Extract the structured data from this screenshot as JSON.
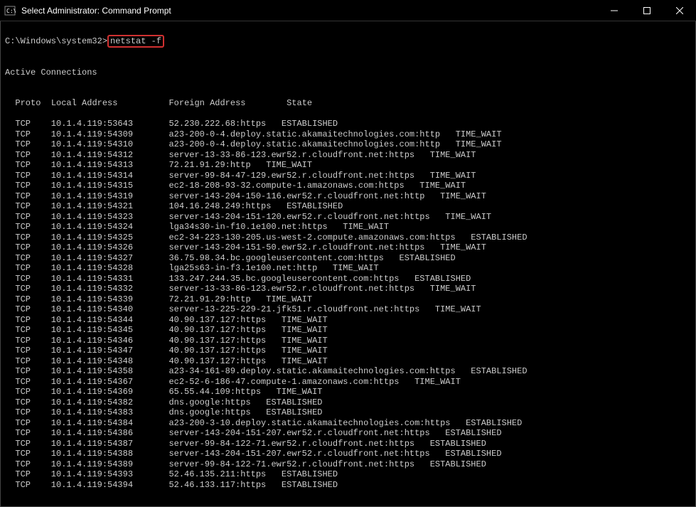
{
  "titlebar": {
    "title": "Select Administrator: Command Prompt"
  },
  "prompt": {
    "path": "C:\\Windows\\system32>",
    "command": "netstat -f"
  },
  "header": "Active Connections",
  "columns": {
    "proto": "Proto",
    "local": "Local Address",
    "foreign": "Foreign Address",
    "state": "State"
  },
  "connections": [
    {
      "proto": "TCP",
      "local": "10.1.4.119:53643",
      "foreign": "52.230.222.68:https",
      "state": "ESTABLISHED"
    },
    {
      "proto": "TCP",
      "local": "10.1.4.119:54309",
      "foreign": "a23-200-0-4.deploy.static.akamaitechnologies.com:http",
      "state": "TIME_WAIT"
    },
    {
      "proto": "TCP",
      "local": "10.1.4.119:54310",
      "foreign": "a23-200-0-4.deploy.static.akamaitechnologies.com:http",
      "state": "TIME_WAIT"
    },
    {
      "proto": "TCP",
      "local": "10.1.4.119:54312",
      "foreign": "server-13-33-86-123.ewr52.r.cloudfront.net:https",
      "state": "TIME_WAIT"
    },
    {
      "proto": "TCP",
      "local": "10.1.4.119:54313",
      "foreign": "72.21.91.29:http",
      "state": "TIME_WAIT"
    },
    {
      "proto": "TCP",
      "local": "10.1.4.119:54314",
      "foreign": "server-99-84-47-129.ewr52.r.cloudfront.net:https",
      "state": "TIME_WAIT"
    },
    {
      "proto": "TCP",
      "local": "10.1.4.119:54315",
      "foreign": "ec2-18-208-93-32.compute-1.amazonaws.com:https",
      "state": "TIME_WAIT"
    },
    {
      "proto": "TCP",
      "local": "10.1.4.119:54319",
      "foreign": "server-143-204-150-116.ewr52.r.cloudfront.net:http",
      "state": "TIME_WAIT"
    },
    {
      "proto": "TCP",
      "local": "10.1.4.119:54321",
      "foreign": "104.16.248.249:https",
      "state": "ESTABLISHED"
    },
    {
      "proto": "TCP",
      "local": "10.1.4.119:54323",
      "foreign": "server-143-204-151-120.ewr52.r.cloudfront.net:https",
      "state": "TIME_WAIT"
    },
    {
      "proto": "TCP",
      "local": "10.1.4.119:54324",
      "foreign": "lga34s30-in-f10.1e100.net:https",
      "state": "TIME_WAIT"
    },
    {
      "proto": "TCP",
      "local": "10.1.4.119:54325",
      "foreign": "ec2-34-223-130-205.us-west-2.compute.amazonaws.com:https",
      "state": "ESTABLISHED"
    },
    {
      "proto": "TCP",
      "local": "10.1.4.119:54326",
      "foreign": "server-143-204-151-50.ewr52.r.cloudfront.net:https",
      "state": "TIME_WAIT"
    },
    {
      "proto": "TCP",
      "local": "10.1.4.119:54327",
      "foreign": "36.75.98.34.bc.googleusercontent.com:https",
      "state": "ESTABLISHED"
    },
    {
      "proto": "TCP",
      "local": "10.1.4.119:54328",
      "foreign": "lga25s63-in-f3.1e100.net:http",
      "state": "TIME_WAIT"
    },
    {
      "proto": "TCP",
      "local": "10.1.4.119:54331",
      "foreign": "133.247.244.35.bc.googleusercontent.com:https",
      "state": "ESTABLISHED"
    },
    {
      "proto": "TCP",
      "local": "10.1.4.119:54332",
      "foreign": "server-13-33-86-123.ewr52.r.cloudfront.net:https",
      "state": "TIME_WAIT"
    },
    {
      "proto": "TCP",
      "local": "10.1.4.119:54339",
      "foreign": "72.21.91.29:http",
      "state": "TIME_WAIT"
    },
    {
      "proto": "TCP",
      "local": "10.1.4.119:54340",
      "foreign": "server-13-225-229-21.jfk51.r.cloudfront.net:https",
      "state": "TIME_WAIT"
    },
    {
      "proto": "TCP",
      "local": "10.1.4.119:54344",
      "foreign": "40.90.137.127:https",
      "state": "TIME_WAIT"
    },
    {
      "proto": "TCP",
      "local": "10.1.4.119:54345",
      "foreign": "40.90.137.127:https",
      "state": "TIME_WAIT"
    },
    {
      "proto": "TCP",
      "local": "10.1.4.119:54346",
      "foreign": "40.90.137.127:https",
      "state": "TIME_WAIT"
    },
    {
      "proto": "TCP",
      "local": "10.1.4.119:54347",
      "foreign": "40.90.137.127:https",
      "state": "TIME_WAIT"
    },
    {
      "proto": "TCP",
      "local": "10.1.4.119:54348",
      "foreign": "40.90.137.127:https",
      "state": "TIME_WAIT"
    },
    {
      "proto": "TCP",
      "local": "10.1.4.119:54358",
      "foreign": "a23-34-161-89.deploy.static.akamaitechnologies.com:https",
      "state": "ESTABLISHED"
    },
    {
      "proto": "TCP",
      "local": "10.1.4.119:54367",
      "foreign": "ec2-52-6-186-47.compute-1.amazonaws.com:https",
      "state": "TIME_WAIT"
    },
    {
      "proto": "TCP",
      "local": "10.1.4.119:54369",
      "foreign": "65.55.44.109:https",
      "state": "TIME_WAIT"
    },
    {
      "proto": "TCP",
      "local": "10.1.4.119:54382",
      "foreign": "dns.google:https",
      "state": "ESTABLISHED"
    },
    {
      "proto": "TCP",
      "local": "10.1.4.119:54383",
      "foreign": "dns.google:https",
      "state": "ESTABLISHED"
    },
    {
      "proto": "TCP",
      "local": "10.1.4.119:54384",
      "foreign": "a23-200-3-10.deploy.static.akamaitechnologies.com:https",
      "state": "ESTABLISHED"
    },
    {
      "proto": "TCP",
      "local": "10.1.4.119:54386",
      "foreign": "server-143-204-151-207.ewr52.r.cloudfront.net:https",
      "state": "ESTABLISHED"
    },
    {
      "proto": "TCP",
      "local": "10.1.4.119:54387",
      "foreign": "server-99-84-122-71.ewr52.r.cloudfront.net:https",
      "state": "ESTABLISHED"
    },
    {
      "proto": "TCP",
      "local": "10.1.4.119:54388",
      "foreign": "server-143-204-151-207.ewr52.r.cloudfront.net:https",
      "state": "ESTABLISHED"
    },
    {
      "proto": "TCP",
      "local": "10.1.4.119:54389",
      "foreign": "server-99-84-122-71.ewr52.r.cloudfront.net:https",
      "state": "ESTABLISHED"
    },
    {
      "proto": "TCP",
      "local": "10.1.4.119:54393",
      "foreign": "52.46.135.211:https",
      "state": "ESTABLISHED"
    },
    {
      "proto": "TCP",
      "local": "10.1.4.119:54394",
      "foreign": "52.46.133.117:https",
      "state": "ESTABLISHED"
    }
  ]
}
